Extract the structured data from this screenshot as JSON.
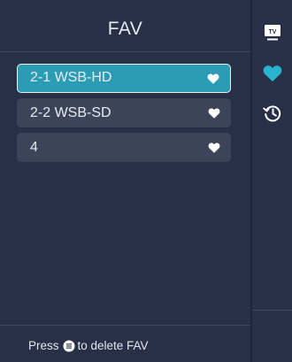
{
  "panel": {
    "title": "FAV"
  },
  "channels": [
    {
      "label": "2-1  WSB-HD",
      "selected": true
    },
    {
      "label": "2-2  WSB-SD",
      "selected": false
    },
    {
      "label": "4",
      "selected": false
    }
  ],
  "footer": {
    "prefix": "Press",
    "suffix": "to delete FAV",
    "key_icon": "menu-key-icon"
  },
  "sidebar": {
    "items": [
      {
        "icon": "tv-icon"
      },
      {
        "icon": "heart-icon",
        "active": true
      },
      {
        "icon": "history-icon"
      }
    ]
  },
  "colors": {
    "background": "#283048",
    "item": "#3b4459",
    "selected": "#2a9db5",
    "accent": "#28b4cf"
  }
}
